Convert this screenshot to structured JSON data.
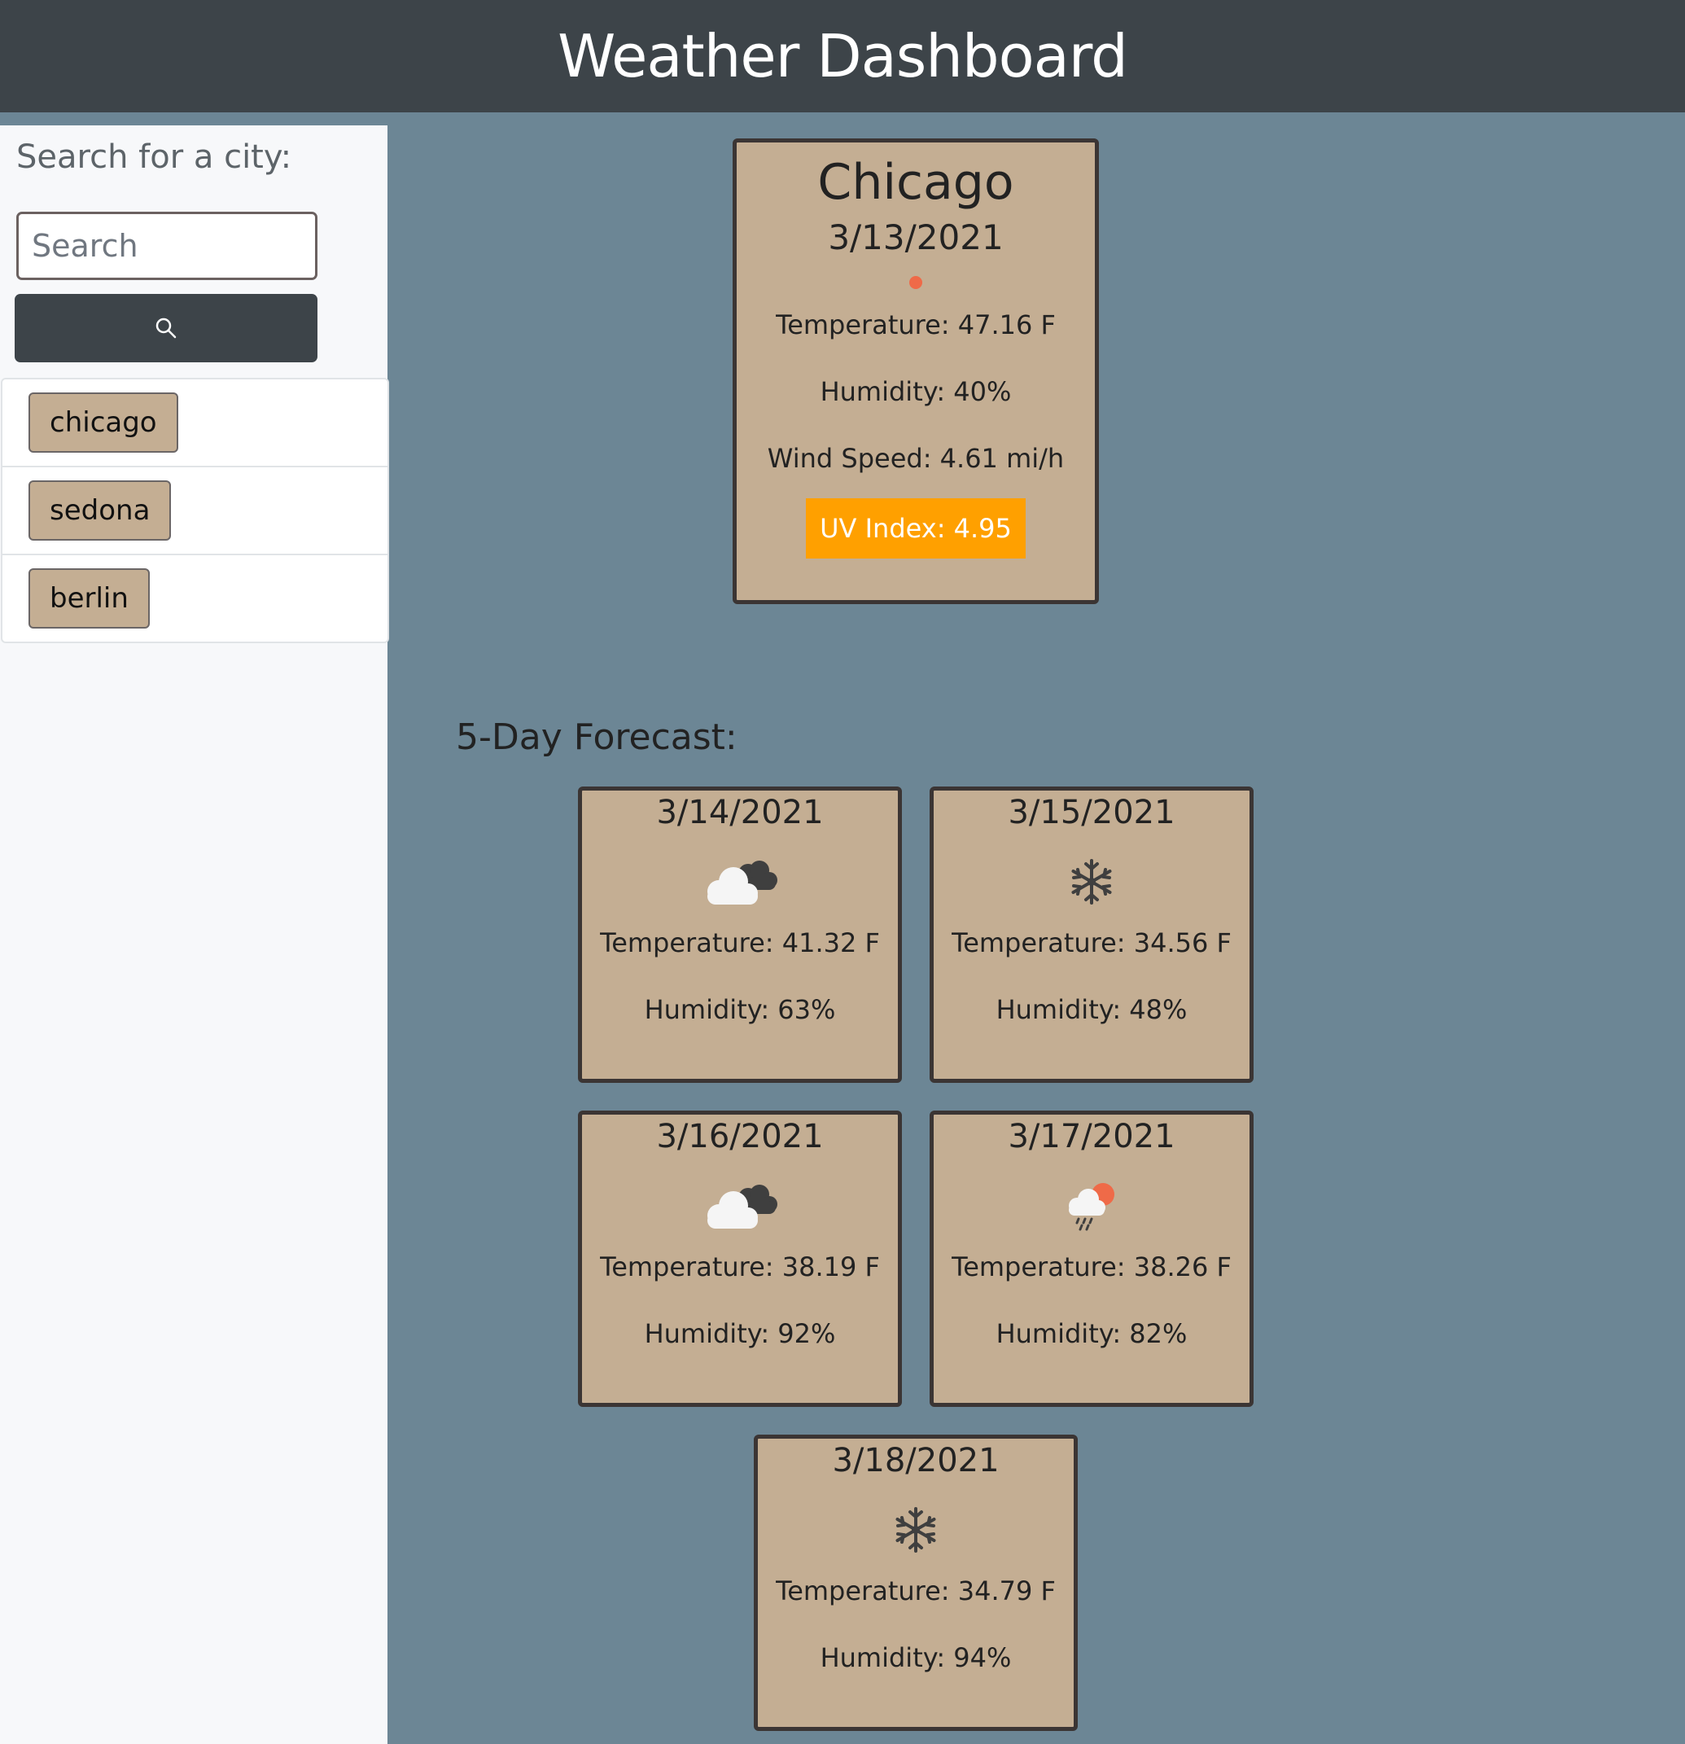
{
  "header": {
    "title": "Weather Dashboard"
  },
  "sidebar": {
    "search_label": "Search for a city:",
    "search_placeholder": "Search",
    "search_button_icon": "search-icon",
    "history": [
      {
        "label": "chicago"
      },
      {
        "label": "sedona"
      },
      {
        "label": "berlin"
      }
    ]
  },
  "current": {
    "city": "Chicago",
    "date": "3/13/2021",
    "icon": "sun-dot-icon",
    "temperature": "Temperature: 47.16 F",
    "humidity": "Humidity: 40%",
    "wind": "Wind Speed: 4.61 mi/h",
    "uv": "UV Index: 4.95",
    "uv_color": "#ffa000"
  },
  "forecast": {
    "title": "5-Day Forecast:",
    "days": [
      {
        "date": "3/14/2021",
        "icon": "broken-clouds-icon",
        "temperature": "Temperature: 41.32 F",
        "humidity": "Humidity: 63%"
      },
      {
        "date": "3/15/2021",
        "icon": "snowflake-icon",
        "temperature": "Temperature: 34.56 F",
        "humidity": "Humidity: 48%"
      },
      {
        "date": "3/16/2021",
        "icon": "broken-clouds-icon",
        "temperature": "Temperature: 38.19 F",
        "humidity": "Humidity: 92%"
      },
      {
        "date": "3/17/2021",
        "icon": "rain-sun-icon",
        "temperature": "Temperature: 38.26 F",
        "humidity": "Humidity: 82%"
      },
      {
        "date": "3/18/2021",
        "icon": "snowflake-icon",
        "temperature": "Temperature: 34.79 F",
        "humidity": "Humidity: 94%"
      }
    ]
  },
  "colors": {
    "header_bg": "#3d4449",
    "page_bg": "#6c8695",
    "card_bg": "#c4ae93",
    "card_border": "#3b3534",
    "sidebar_bg": "#f7f8fa",
    "sun": "#ef6a48"
  }
}
